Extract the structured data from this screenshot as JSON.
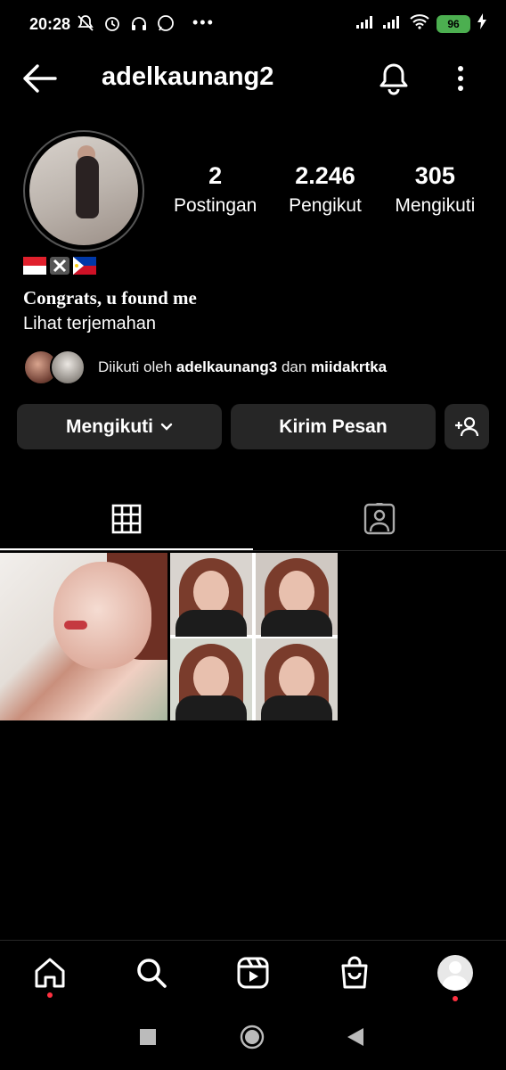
{
  "status_bar": {
    "time": "20:28",
    "battery": "96",
    "left_icons": [
      "mute-icon",
      "alarm-icon",
      "headset-icon",
      "whatsapp-icon"
    ],
    "right_icons": [
      "signal-icon",
      "signal-icon",
      "wifi-icon",
      "battery-icon",
      "charging-icon"
    ]
  },
  "header": {
    "username": "adelkaunang2"
  },
  "profile": {
    "stats": [
      {
        "value": "2",
        "label": "Postingan"
      },
      {
        "value": "2.246",
        "label": "Pengikut"
      },
      {
        "value": "305",
        "label": "Mengikuti"
      }
    ],
    "flags": "🇮🇩✖️🇵🇭",
    "bio": "Congrats, u found me",
    "translate_label": "Lihat terjemahan",
    "followed_by": {
      "prefix": "Diikuti oleh ",
      "user1": "adelkaunang3",
      "joiner": " dan ",
      "user2": "miidakrtka"
    }
  },
  "buttons": {
    "following": "Mengikuti",
    "message": "Kirim Pesan"
  },
  "tabs": [
    "grid-tab",
    "tagged-tab"
  ],
  "bottom_nav": [
    "home-icon",
    "search-icon",
    "reels-icon",
    "shop-icon",
    "profile-avatar"
  ],
  "colors": {
    "background": "#000000",
    "button_bg": "#262626",
    "notification_dot": "#ff3040",
    "battery": "#4caf50"
  }
}
